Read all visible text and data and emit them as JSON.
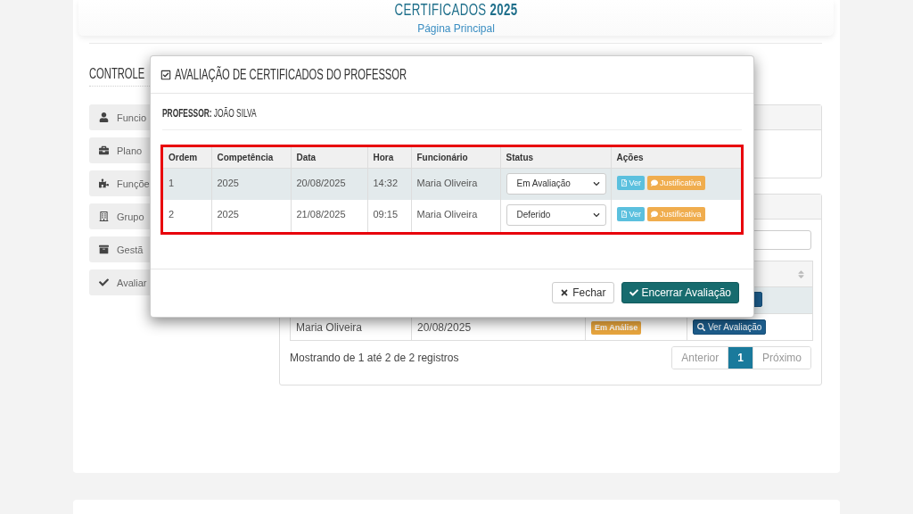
{
  "header": {
    "title": "CERTIFICADOS **2025**",
    "link": "Página Principal"
  },
  "sidebar": {
    "heading": "CONTROLE",
    "items": [
      "Funcio",
      "Plano",
      "Funçõe",
      "Grupo",
      "Gestã",
      "Avaliar"
    ]
  },
  "background_panel": {
    "table": {
      "rows": [
        {
          "highlighted": true
        },
        {
          "highlighted": false,
          "cells": [
            "Maria Oliveira",
            "20/08/2025"
          ],
          "status": "Em Análise",
          "action": "Ver Avaliação"
        }
      ]
    },
    "summary": "Mostrando de 1 até 2 de 2 registros",
    "pagination": [
      {
        "label": "Anterior",
        "selected": false,
        "disabled": true
      },
      {
        "label": "1",
        "selected": true,
        "disabled": false
      },
      {
        "label": "Próximo",
        "selected": false,
        "disabled": true
      }
    ]
  },
  "modal": {
    "title": "AVALIAÇÃO DE CERTIFICADOS DO PROFESSOR",
    "professor": "**PROFESSOR:** JOÃO SILVA",
    "table": {
      "columns": [
        "Ordem",
        "Competência",
        "Data",
        "Hora",
        "Funcionário",
        "Status",
        "Ações"
      ],
      "rows": [
        {
          "highlighted": true,
          "cells": [
            "1",
            "2025",
            "20/08/2025",
            "14:32",
            "Maria Oliveira"
          ],
          "status": "Em Avaliação",
          "actions": [
            {
              "kind": "view",
              "label": "Ver"
            },
            {
              "kind": "justify",
              "label": "Justificativa"
            }
          ]
        },
        {
          "highlighted": false,
          "cells": [
            "2",
            "2025",
            "21/08/2025",
            "09:15",
            "Maria Oliveira"
          ],
          "status": "Deferido",
          "actions": [
            {
              "kind": "view",
              "label": "Ver"
            },
            {
              "kind": "justify",
              "label": "Justificativa"
            }
          ]
        }
      ]
    },
    "buttons": [
      {
        "kind": "close",
        "label": "Fechar"
      },
      {
        "kind": "confirm",
        "label": "Encerrar Avaliação"
      }
    ]
  }
}
